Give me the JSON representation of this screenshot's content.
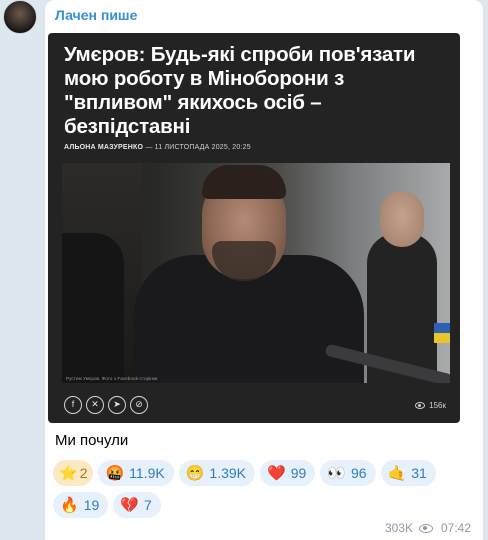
{
  "channel": {
    "sender_name": "Лачен пише"
  },
  "article_card": {
    "headline": "Умєров: Будь-які спроби пов'язати мою роботу в Міноборони з \"впливом\" якихось осіб – безпідставні",
    "author": "Альона Мазуренко",
    "date": "— 11 листопада 2025, 20:25",
    "photo_caption": "Рустем Умєров. Фото з Facebook-сторінки",
    "social_icons": [
      "facebook-icon",
      "x-icon",
      "telegram-icon",
      "link-icon"
    ],
    "views": "156к"
  },
  "message": {
    "text": "Ми почули",
    "views": "303K",
    "time": "07:42"
  },
  "reactions": [
    {
      "emoji": "⭐",
      "count": "2",
      "name": "star"
    },
    {
      "emoji": "🤬",
      "count": "11.9K",
      "name": "angry"
    },
    {
      "emoji": "😁",
      "count": "1.39K",
      "name": "grin"
    },
    {
      "emoji": "❤️",
      "count": "99",
      "name": "heart"
    },
    {
      "emoji": "👀",
      "count": "96",
      "name": "eyes"
    },
    {
      "emoji": "🤙",
      "count": "31",
      "name": "call-me"
    },
    {
      "emoji": "🔥",
      "count": "19",
      "name": "fire"
    },
    {
      "emoji": "💔",
      "count": "7",
      "name": "broken-heart"
    }
  ],
  "colors": {
    "sender": "#3a8fd4",
    "reaction_bg": "#e7f1fb",
    "reaction_text": "#2f7cc4",
    "star_bg": "#fbe9c5"
  }
}
